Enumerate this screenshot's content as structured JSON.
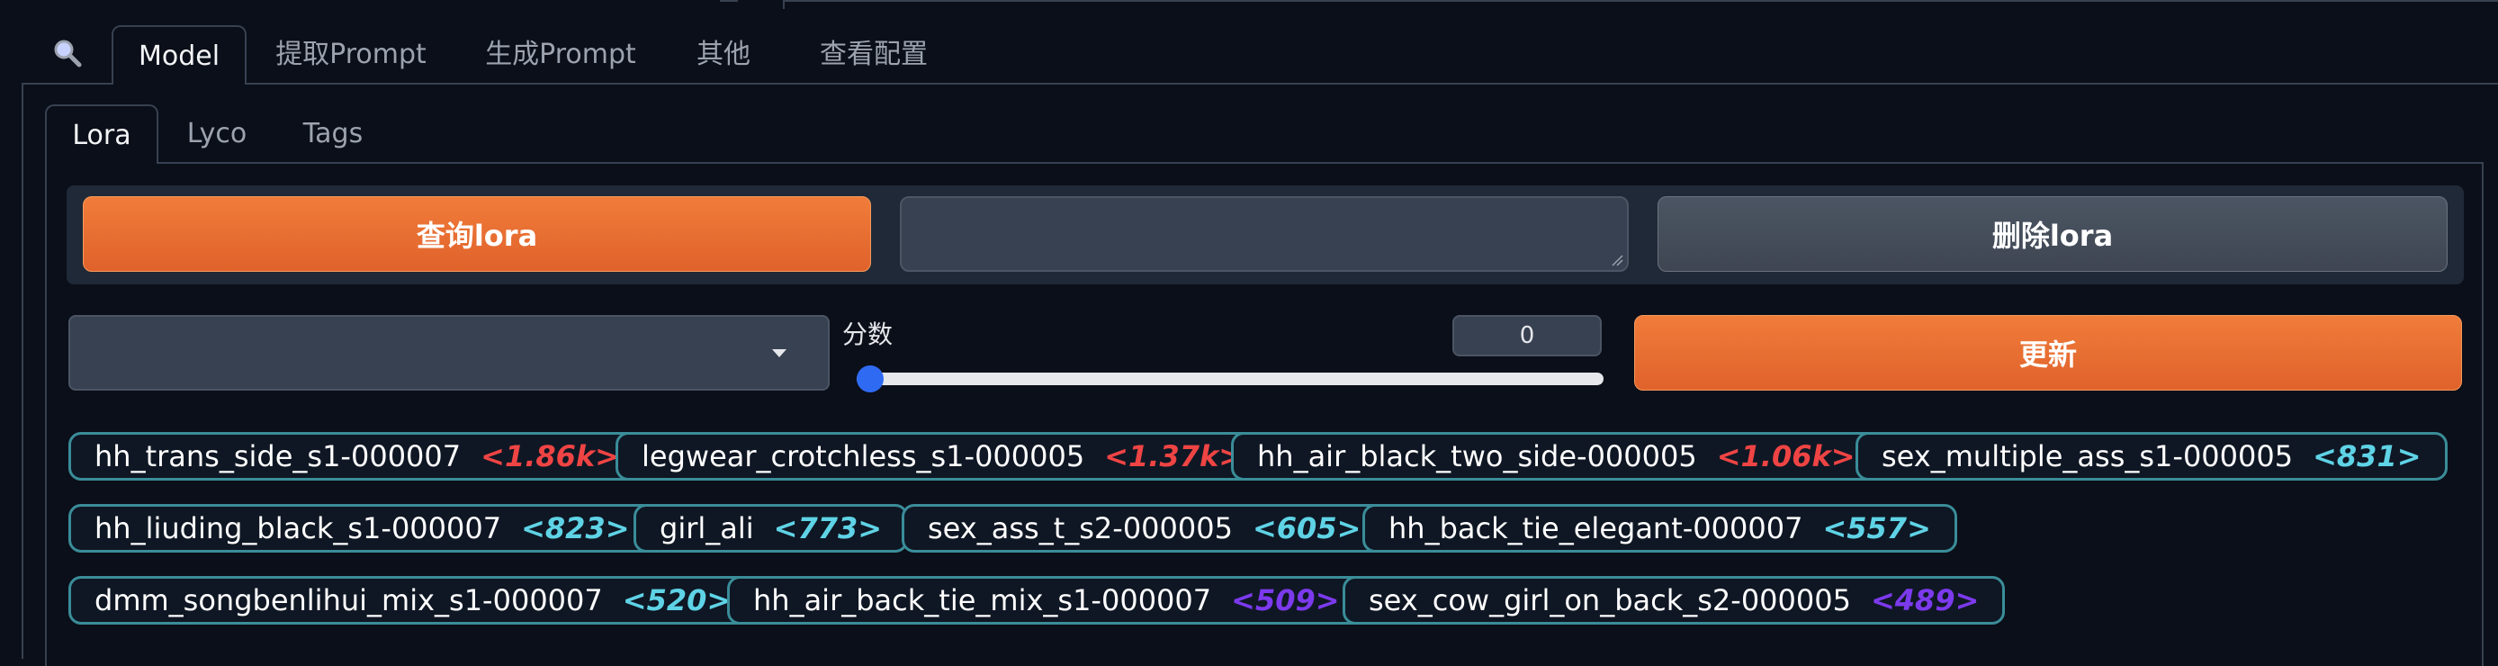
{
  "main_tabs": [
    {
      "label": "Model",
      "active": true
    },
    {
      "label": "提取Prompt"
    },
    {
      "label": "生成Prompt"
    },
    {
      "label": "其他"
    },
    {
      "label": "查看配置"
    }
  ],
  "search_icon": "magnifier-icon",
  "sub_tabs": [
    {
      "label": "Lora",
      "active": true
    },
    {
      "label": "Lyco"
    },
    {
      "label": "Tags"
    }
  ],
  "buttons": {
    "query": "查询lora",
    "delete": "删除lora",
    "update": "更新"
  },
  "textarea": {
    "value": ""
  },
  "dropdown": {
    "value": ""
  },
  "slider": {
    "label": "分数",
    "value": "0",
    "fraction": 0.0
  },
  "colors": {
    "accent_orange": "#e8692f",
    "tag_border": "#3a8d99",
    "count_red": "#ef4444",
    "count_cyan": "#5fd3e6",
    "count_purple": "#7c3aed",
    "slider_blue": "#2563eb"
  },
  "tags": [
    {
      "name": "hh_trans_side_s1-000007",
      "count": "<1.86k>",
      "tone": "red"
    },
    {
      "name": "legwear_crotchless_s1-000005",
      "count": "<1.37k>",
      "tone": "red"
    },
    {
      "name": "hh_air_black_two_side-000005",
      "count": "<1.06k>",
      "tone": "red"
    },
    {
      "name": "sex_multiple_ass_s1-000005",
      "count": "<831>",
      "tone": "cyan"
    },
    {
      "name": "hh_liuding_black_s1-000007",
      "count": "<823>",
      "tone": "cyan"
    },
    {
      "name": "girl_ali",
      "count": "<773>",
      "tone": "cyan"
    },
    {
      "name": "sex_ass_t_s2-000005",
      "count": "<605>",
      "tone": "cyan"
    },
    {
      "name": "hh_back_tie_elegant-000007",
      "count": "<557>",
      "tone": "cyan"
    },
    {
      "name": "dmm_songbenlihui_mix_s1-000007",
      "count": "<520>",
      "tone": "cyan"
    },
    {
      "name": "hh_air_back_tie_mix_s1-000007",
      "count": "<509>",
      "tone": "purple"
    },
    {
      "name": "sex_cow_girl_on_back_s2-000005",
      "count": "<489>",
      "tone": "purple"
    }
  ]
}
